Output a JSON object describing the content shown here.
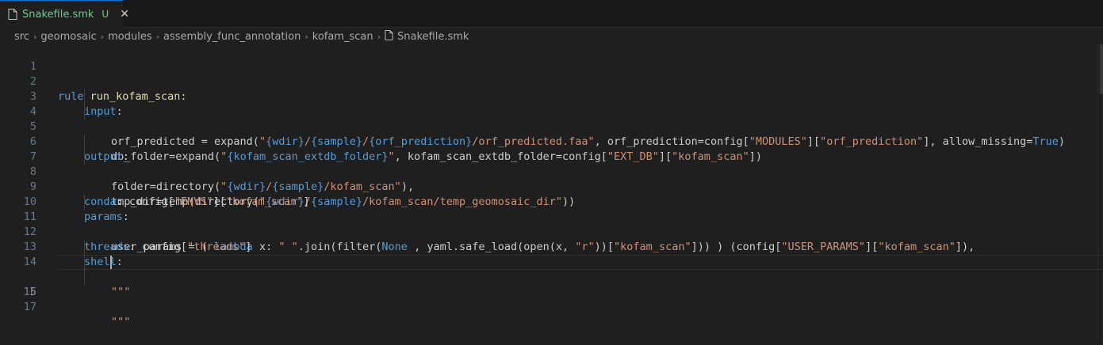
{
  "tab": {
    "filename": "Snakefile.smk",
    "badge": "U",
    "close": "✕",
    "icon": "file-icon"
  },
  "breadcrumb": {
    "items": [
      "src",
      "geomosaic",
      "modules",
      "assembly_func_annotation",
      "kofam_scan"
    ],
    "file": "Snakefile.smk",
    "separator": "›"
  },
  "colors": {
    "keyword": "#569cd6",
    "string": "#ce9178",
    "variable": "#9cdcfe",
    "modified": "#73c991",
    "accent": "#0078d4"
  },
  "editor": {
    "active_line": 15,
    "line_numbers": [
      "1",
      "2",
      "3",
      "4",
      "5",
      "6",
      "7",
      "8",
      "9",
      "10",
      "11",
      "12",
      "13",
      "14",
      "15",
      "16",
      "17"
    ],
    "tokens": {
      "l2_rule": "rule",
      "l2_name": " run_kofam_scan:",
      "l3_input": "input",
      "l3_colon": ":",
      "l4_a": "orf_predicted = expand(",
      "l4_s1": "\"",
      "l4_v1": "{wdir}",
      "l4_s2": "/",
      "l4_v2": "{sample}",
      "l4_s3": "/",
      "l4_v3": "{orf_prediction}",
      "l4_s4": "/orf_predicted.faa\"",
      "l4_b": ", orf_prediction=config[",
      "l4_s5": "\"MODULES\"",
      "l4_c": "][",
      "l4_s6": "\"orf_prediction\"",
      "l4_d": "], allow_missing=",
      "l4_true": "True",
      "l4_e": ")",
      "l5_a": "db_folder=expand(",
      "l5_s1": "\"",
      "l5_v1": "{kofam_scan_extdb_folder}",
      "l5_s2": "\"",
      "l5_b": ", kofam_scan_extdb_folder=config[",
      "l5_s3": "\"EXT_DB\"",
      "l5_c": "][",
      "l5_s4": "\"kofam_scan\"",
      "l5_d": "])",
      "l6_output": "output",
      "l6_colon": ":",
      "l7_a": "folder=directory(",
      "l7_s1": "\"",
      "l7_v1": "{wdir}",
      "l7_s2": "/",
      "l7_v2": "{sample}",
      "l7_s3": "/kofam_scan\"",
      "l7_b": "),",
      "l8_a": "tmp_dir=temp(directory(",
      "l8_s1": "\"",
      "l8_v1": "{wdir}",
      "l8_s2": "/",
      "l8_v2": "{sample}",
      "l8_s3": "/kofam_scan/temp_geomosaic_dir\"",
      "l8_b": "))",
      "l9_conda": "conda",
      "l9_a": ": config[",
      "l9_s1": "\"ENVS\"",
      "l9_b": "][",
      "l9_s2": "\"kofam_scan\"",
      "l9_c": "]",
      "l10_params": "params",
      "l10_colon": ":",
      "l11_a": "user_params = ( ",
      "l11_lambda": "lambda",
      "l11_x": " x",
      "l11_b": ": ",
      "l11_s1": "\" \"",
      "l11_c": ".join(filter(",
      "l11_none": "None",
      "l11_d": " , yaml.safe_load(open(x, ",
      "l11_s2": "\"r\"",
      "l11_e": "))[",
      "l11_s3": "\"kofam_scan\"",
      "l11_f": "])) ) (config[",
      "l11_s4": "\"USER_PARAMS\"",
      "l11_g": "][",
      "l11_s5": "\"kofam_scan\"",
      "l11_h": "]),",
      "l12_threads": "threads",
      "l12_a": ": config[",
      "l12_s1": "\"threads\"",
      "l12_b": "]",
      "l13_shell": "shell",
      "l13_colon": ":",
      "l14_s": "\"\"\"",
      "l16_s": "\"\"\""
    }
  }
}
